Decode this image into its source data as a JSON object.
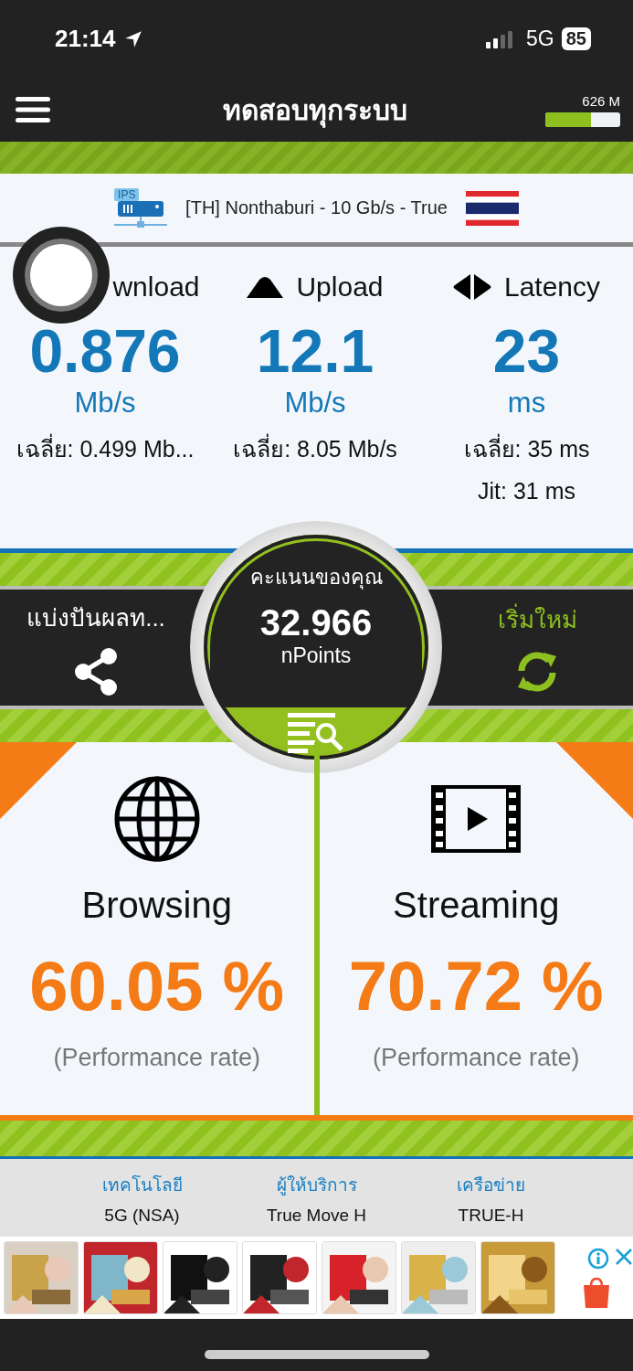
{
  "status_bar": {
    "time": "21:14",
    "network": "5G",
    "battery": "85"
  },
  "header": {
    "title": "ทดสอบทุกระบบ",
    "data_used": "626 M",
    "level": 0.61
  },
  "server": {
    "name": "[TH] Nonthaburi - 10 Gb/s - True",
    "badge": "IPS"
  },
  "metrics": [
    {
      "kind": "download",
      "label": "wnload",
      "value": "0.876",
      "unit": "Mb/s",
      "average": "เฉลี่ย: 0.499 Mb..."
    },
    {
      "kind": "upload",
      "label": "Upload",
      "value": "12.1",
      "unit": "Mb/s",
      "average": "เฉลี่ย: 8.05 Mb/s"
    },
    {
      "kind": "latency",
      "label": "Latency",
      "value": "23",
      "unit": "ms",
      "average": "เฉลี่ย: 35 ms",
      "jitter": "Jit: 31 ms"
    }
  ],
  "share": {
    "label": "แบ่งปันผลท..."
  },
  "score": {
    "title": "คะแนนของคุณ",
    "value": "32.966",
    "unit": "nPoints"
  },
  "restart": {
    "label": "เริ่มใหม่"
  },
  "results": [
    {
      "kind": "browsing",
      "title": "Browsing",
      "value": "60.05 %",
      "caption": "(Performance rate)"
    },
    {
      "kind": "streaming",
      "title": "Streaming",
      "value": "70.72 %",
      "caption": "(Performance rate)"
    }
  ],
  "info": [
    {
      "label": "เทคโนโลยี",
      "value": "5G (NSA)"
    },
    {
      "label": "ผู้ให้บริการ",
      "value": "True Move H"
    },
    {
      "label": "เครือข่าย",
      "value": "TRUE-H"
    }
  ]
}
